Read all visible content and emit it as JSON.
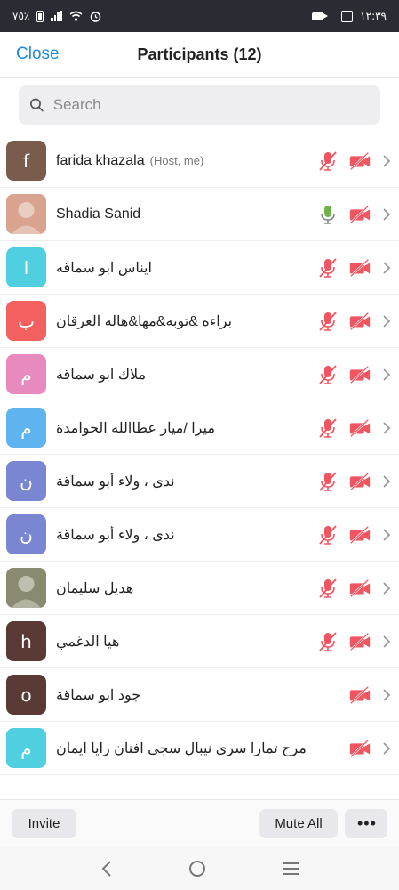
{
  "status_bar": {
    "battery_text": "٧٥٪",
    "time": "١٢:٣٩"
  },
  "header": {
    "close_label": "Close",
    "title": "Participants (12)"
  },
  "search": {
    "placeholder": "Search",
    "icon": "search-icon"
  },
  "colors": {
    "accent": "#1d8cd8",
    "muted_red": "#f2555f",
    "mic_on_green": "#6fb24a"
  },
  "participants": [
    {
      "name": "farida khazala",
      "role": "(Host, me)",
      "initial": "f",
      "avatar_color": "#7a5c4e",
      "mic": "muted",
      "video": "off"
    },
    {
      "name": "Shadia Sanid",
      "role": "",
      "initial": "",
      "avatar_color": "#d9a48f",
      "mic": "on",
      "video": "off"
    },
    {
      "name": "ايناس ابو سماقه",
      "role": "",
      "initial": "ا",
      "avatar_color": "#4fcfe0",
      "mic": "muted",
      "video": "off"
    },
    {
      "name": "براءه &توبه&مها&هاله العرقان",
      "role": "",
      "initial": "ب",
      "avatar_color": "#f2605f",
      "mic": "muted",
      "video": "off"
    },
    {
      "name": "ملاك ابو سماقه",
      "role": "",
      "initial": "م",
      "avatar_color": "#e98abf",
      "mic": "muted",
      "video": "off"
    },
    {
      "name": "ميرا /ميار عطاالله الحوامدة",
      "role": "",
      "initial": "م",
      "avatar_color": "#5fb4f0",
      "mic": "muted",
      "video": "off"
    },
    {
      "name": "ندى ، ولاء أبو سماقة",
      "role": "",
      "initial": "ن",
      "avatar_color": "#7a86d1",
      "mic": "muted",
      "video": "off"
    },
    {
      "name": "ندى ، ولاء أبو سماقة",
      "role": "",
      "initial": "ن",
      "avatar_color": "#7a86d1",
      "mic": "muted",
      "video": "off"
    },
    {
      "name": "هديل سليمان",
      "role": "",
      "initial": "",
      "avatar_color": "#8a8a70",
      "mic": "muted",
      "video": "off"
    },
    {
      "name": "هيا الدغمي",
      "role": "",
      "initial": "h",
      "avatar_color": "#5a3a34",
      "mic": "muted",
      "video": "off"
    },
    {
      "name": "جود ابو سماقة",
      "role": "",
      "initial": "o",
      "avatar_color": "#5a3a34",
      "mic": "none",
      "video": "off"
    },
    {
      "name": "مرح تمارا سرى نيبال سجى افنان رايا ايمان",
      "role": "",
      "initial": "م",
      "avatar_color": "#4fcfe0",
      "mic": "none",
      "video": "off"
    }
  ],
  "footer": {
    "invite_label": "Invite",
    "mute_all_label": "Mute All",
    "more_label": "•••"
  }
}
